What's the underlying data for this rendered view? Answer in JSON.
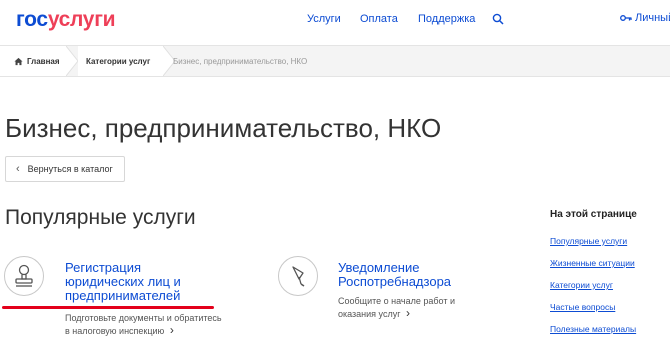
{
  "header": {
    "logo_part1": "гос",
    "logo_part2": "услуги",
    "nav": [
      "Услуги",
      "Оплата",
      "Поддержка"
    ],
    "personal_label": "Личный"
  },
  "breadcrumb": [
    "Главная",
    "Категории услуг",
    "Бизнес, предпринимательство, НКО"
  ],
  "page_title": "Бизнес, предпринимательство, НКО",
  "back_button": "Вернуться в каталог",
  "popular_heading": "Популярные услуги",
  "cards": [
    {
      "title": "Регистрация юридических лиц и предпринимателей",
      "desc": "Подготовьте документы и обратитесь в налоговую инспекцию"
    },
    {
      "title": "Уведомление Роспотребнадзора",
      "desc": "Сообщите о начале работ и оказания услуг"
    }
  ],
  "sidebar": {
    "title": "На этой странице",
    "links": [
      "Популярные услуги",
      "Жизненные ситуации",
      "Категории услуг",
      "Частые вопросы",
      "Полезные материалы"
    ]
  },
  "colors": {
    "brand_blue": "#0d4cd3",
    "brand_red": "#ee3f58",
    "highlight": "#e3001b"
  }
}
